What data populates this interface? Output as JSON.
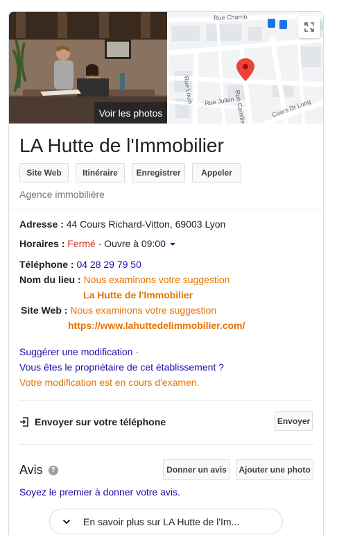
{
  "header": {
    "photos_label": "Voir les photos",
    "map_labels": {
      "street1": "Rue Charrin",
      "street2": "Rue Louis",
      "street3": "Rue Camille",
      "street4": "Rue Julien",
      "street5": "Cours Dr Long"
    }
  },
  "business": {
    "name": "LA Hutte de l'Immobilier",
    "category": "Agence immobilière"
  },
  "actions": {
    "website": "Site Web",
    "directions": "Itinéraire",
    "save": "Enregistrer",
    "call": "Appeler"
  },
  "details": {
    "address_label": "Adresse :",
    "address_value": "44 Cours Richard-Vitton, 69003 Lyon",
    "hours_label": "Horaires :",
    "hours_status": "Fermé",
    "hours_next": "· Ouvre à 09:00",
    "phone_label": "Téléphone :",
    "phone_value": "04 28 29 79 50",
    "place_name_label": "Nom du lieu :",
    "place_name_pending": "Nous examinons votre suggestion",
    "place_name_suggested": "La Hutte de l'Immobilier",
    "website_label": "Site Web :",
    "website_pending": "Nous examinons votre suggestion",
    "website_suggested": "https://www.lahuttedelimmobilier.com/"
  },
  "edits": {
    "suggest": "Suggérer une modification ·",
    "owner": "Vous êtes le propriétaire de cet établissement ?",
    "pending": "Votre modification est en cours d'examen."
  },
  "send": {
    "label": "Envoyer sur votre téléphone",
    "button": "Envoyer"
  },
  "reviews": {
    "title": "Avis",
    "write": "Donner un avis",
    "add_photo": "Ajouter une photo",
    "first": "Soyez le premier à donner votre avis."
  },
  "more": {
    "label": "En savoir plus sur LA Hutte de l'Im..."
  },
  "colors": {
    "link": "#1a0dab",
    "pending": "#e37400",
    "closed": "#d93025",
    "map_pin": "#ea4335"
  }
}
